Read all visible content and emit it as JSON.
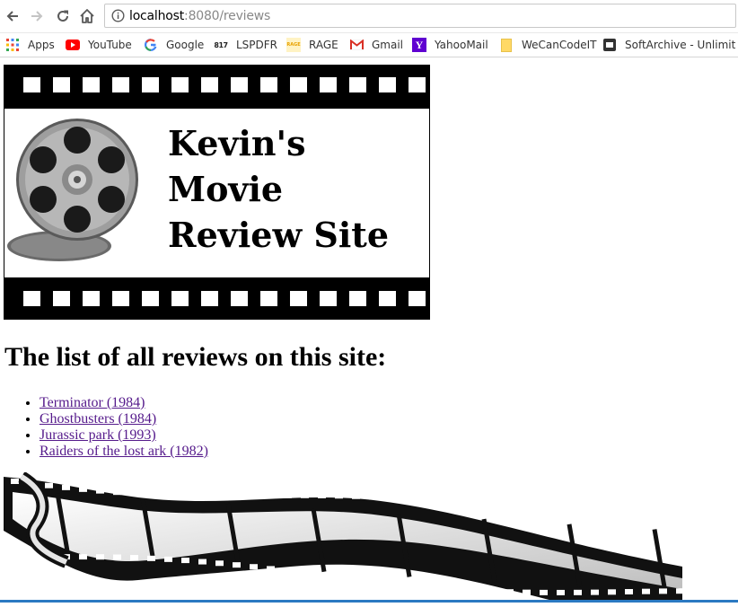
{
  "browser": {
    "url_host": "localhost",
    "url_rest": ":8080/reviews",
    "bookmarks": [
      {
        "label": "Apps",
        "icon": "apps-grid-icon"
      },
      {
        "label": "YouTube",
        "icon": "youtube-icon"
      },
      {
        "label": "Google",
        "icon": "google-icon"
      },
      {
        "label": "LSPDFR",
        "icon": "lspdfr-icon"
      },
      {
        "label": "RAGE",
        "icon": "rage-icon"
      },
      {
        "label": "Gmail",
        "icon": "gmail-icon"
      },
      {
        "label": "YahooMail",
        "icon": "yahoo-icon"
      },
      {
        "label": "WeCanCodeIT",
        "icon": "folder-icon"
      },
      {
        "label": "SoftArchive - Unlimit",
        "icon": "softarchive-icon"
      }
    ]
  },
  "banner": {
    "title_lines": [
      "Kevin's",
      "Movie",
      "Review Site"
    ],
    "lspdfr_icon_text": "817",
    "rage_icon_text": "RAGE"
  },
  "content": {
    "heading": "The list of all reviews on this site:",
    "reviews": [
      "Terminator (1984)",
      "Ghostbusters (1984)",
      "Jurassic park (1993)",
      "Raiders of the lost ark (1982)"
    ]
  },
  "colors": {
    "link_visited": "#551a8b",
    "youtube_red": "#ff0000",
    "yahoo_purple": "#5f01d1",
    "taskbar": "#2b79c2"
  }
}
